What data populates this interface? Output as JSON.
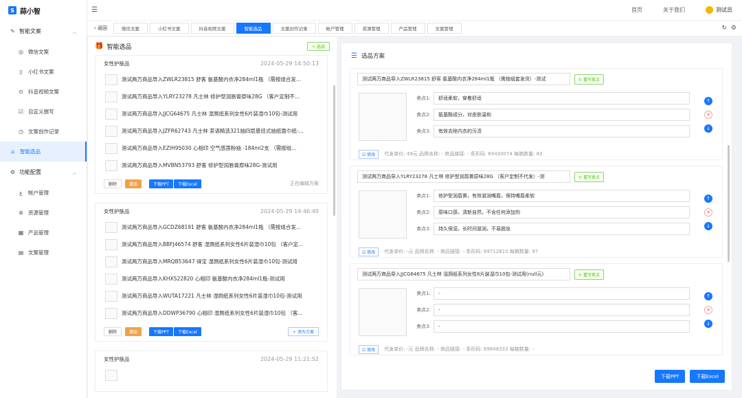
{
  "app": {
    "logo_text": "蒜小智"
  },
  "sidebar": {
    "group1": "智能文案",
    "items1": [
      {
        "label": "微信文案",
        "icon": "wechat-icon"
      },
      {
        "label": "小红书文案",
        "icon": "book-icon"
      },
      {
        "label": "抖音视频文案",
        "icon": "play-icon"
      },
      {
        "label": "自定义撰写",
        "icon": "edit-icon"
      },
      {
        "label": "文案创作记录",
        "icon": "clock-icon"
      },
      {
        "label": "智能选品",
        "icon": "shop-icon",
        "active": true
      }
    ],
    "group2": "功能配置",
    "items2": [
      {
        "label": "帐户管理",
        "icon": "user-icon"
      },
      {
        "label": "资源管理",
        "icon": "resource-icon"
      },
      {
        "label": "产品管理",
        "icon": "grid-icon"
      },
      {
        "label": "文案管理",
        "icon": "file-icon"
      }
    ]
  },
  "topbar": {
    "home": "首页",
    "about": "关于我们",
    "user": "测试员"
  },
  "tabs": {
    "back": "返回",
    "items": [
      "微信文案",
      "小红书文案",
      "抖音视频文案",
      "智能选品",
      "文案创作记录",
      "帐户管理",
      "资源管理",
      "产品管理",
      "文案管理"
    ],
    "active_index": 3
  },
  "left": {
    "title": "智能选品",
    "add_label": "+ 选品",
    "cards": [
      {
        "name": "女性护肤品",
        "time": "2024-05-29 14:50:13",
        "products": [
          "测试两万商品导入ZWLR23815 舒客 氨基酸内衣净284ml1瓶 （需按组合发...",
          "测试两万商品导入YLRY23278 凡士林 修护型润唇膏原味28G （客户定制不...",
          "测试两万商品导入JJCG64675 凡士林 湿厕纸系列女性6片装湿巾10包-测试用",
          "测试两万商品导入JZFR62743 凡士林 茶语精选321抽四层悬挂式抽纸面巾纸-...",
          "测试两万商品导入EZIH95030 心相印 空气感莲粉抽 -184ml2支 （需按组...",
          "测试两万商品导入MVBN53793 舒客 修护型润唇膏原味28G-测试用"
        ],
        "status": "正在编辑方案"
      },
      {
        "name": "女性护肤品",
        "time": "2024-05-29 14:46:49",
        "products": [
          "测试两万商品导入GCDZ68191 舒客 氨基酸内衣净284ml1瓶 （需按组合发...",
          "测试两万商品导入BBFJ46574 舒客 湿厕纸系列女性6片装湿巾10包 （客户定...",
          "测试两万商品导入MRQB53647 得宝 湿厕纸系列女性6片装湿巾10包-测试用",
          "测试两万商品导入KHXS22820 心相印 氨基酸内衣净284ml1瓶-测试用",
          "测试两万商品导入WUTA17221 凡士林 湿厕纸系列女性6片装湿巾10包-测试用",
          "测试两万商品导入DDWP36790 心相印 湿厕纸系列女性6片装湿巾10包 （客..."
        ],
        "plan_btn": "+ 添为方案"
      },
      {
        "name": "女性护肤品",
        "time": "2024-05-29 11:21:52"
      }
    ],
    "btn_delete": "删除",
    "btn_select": "選品",
    "btn_ppt": "下载PPT",
    "btn_excel": "下载Excel"
  },
  "right": {
    "title": "选品方案",
    "rewrite": "重写卖点",
    "edit": "修改",
    "plans": [
      {
        "title": "测试两万商品导入ZWLR23815 舒客 氨基酸内衣净284ml1瓶 （需按组套发货）-测试",
        "points": [
          "舒适柔软，穿着舒适",
          "氨基酸成分，对皮肤温和",
          "有效去除内衣的污渍"
        ],
        "labels": [
          "卖点1:",
          "卖点2:",
          "卖点3:"
        ],
        "meta": "代发单价: 49元 品牌名称: - 商品链接: - 条形码: 69430074 每箱数量: 83"
      },
      {
        "title": "测试两万商品导入YLRY23278 凡士林 修护型润唇膏原味28G （客户定制不代发）-测",
        "points": [
          "修护型润唇膏，有效滋润嘴唇，保持嘴唇柔软",
          "原味口感，清新自然，不含任何添加剂",
          "持久保湿，长时间滋润，不易脱妆"
        ],
        "labels": [
          "卖点1:",
          "卖点2:",
          "卖点3:"
        ],
        "meta": "代发单价: -元 品牌名称: - 商品链接: - 条形码: 69712810 每箱数量: 97"
      },
      {
        "title": "测试两万商品导入JJCG64675 凡士林 湿厕纸系列女性6片装湿巾10包-测试用(null元)",
        "points": [
          "-",
          "-",
          "-"
        ],
        "labels": [
          "卖点1:",
          "卖点2:",
          "卖点3:"
        ],
        "meta": "代发单价: -元 品牌名称: - 商品链接: - 条形码: 69848333 每箱数量: -"
      }
    ],
    "export_ppt": "下载PPT",
    "export_excel": "下载Excel"
  },
  "colors": {
    "primary": "#1677ff",
    "orange": "#f0a24a",
    "green": "#52c41a"
  }
}
